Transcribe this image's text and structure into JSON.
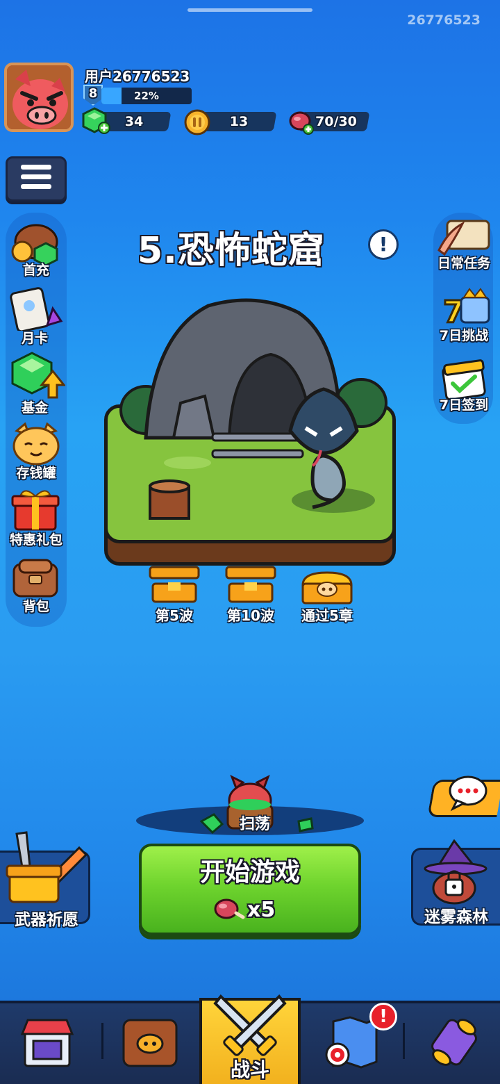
{
  "top": {
    "uid_display": "26776523"
  },
  "profile": {
    "username": "用户26776523",
    "level": "8",
    "xp_percent": 22,
    "xp_label": "22%"
  },
  "resources": {
    "gems": "34",
    "coins": "13",
    "stamina": "70/30"
  },
  "left_menu": [
    {
      "label": "首充",
      "icon": "first-recharge-icon"
    },
    {
      "label": "月卡",
      "icon": "monthly-card-icon"
    },
    {
      "label": "基金",
      "icon": "fund-gem-icon"
    },
    {
      "label": "存钱罐",
      "icon": "piggy-bank-cat-icon"
    },
    {
      "label": "特惠礼包",
      "icon": "gift-box-icon"
    },
    {
      "label": "背包",
      "icon": "backpack-icon"
    }
  ],
  "right_menu": [
    {
      "label": "日常任务",
      "icon": "scroll-quill-icon"
    },
    {
      "label": "7日挑战",
      "icon": "seven-day-challenge-icon"
    },
    {
      "label": "7日签到",
      "icon": "calendar-checkin-icon"
    }
  ],
  "stage": {
    "title": "5.恐怖蛇窟"
  },
  "chests": [
    {
      "label": "第5波",
      "state": "opened"
    },
    {
      "label": "第10波",
      "state": "opened"
    },
    {
      "label": "通过5章",
      "state": "closed"
    }
  ],
  "sweep": {
    "label": "扫荡"
  },
  "start": {
    "label": "开始游戏",
    "cost": "x5"
  },
  "side_buttons": {
    "weapon_wish": "武器祈愿",
    "misty_forest": "迷雾森林"
  },
  "bottom_nav": [
    {
      "icon": "shop-icon",
      "label": ""
    },
    {
      "icon": "hero-chest-icon",
      "label": ""
    },
    {
      "icon": "crossed-swords-icon",
      "label": "战斗"
    },
    {
      "icon": "map-target-icon",
      "label": "",
      "badge": "!"
    },
    {
      "icon": "scroll-tube-icon",
      "label": ""
    }
  ],
  "colors": {
    "background": "#2196ee",
    "start_button": "#6fd42e",
    "battle_tab": "#f7c52a",
    "alert_badge": "#e8202a"
  }
}
